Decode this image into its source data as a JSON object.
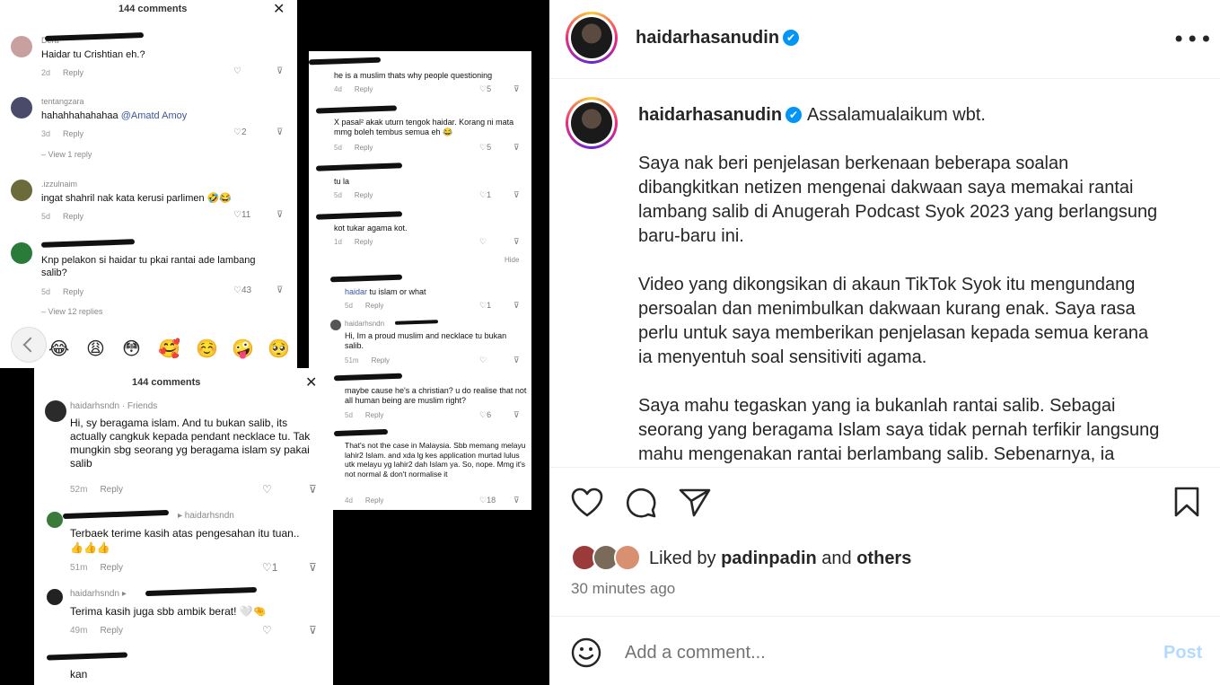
{
  "collage": {
    "shot1": {
      "header": "144 comments",
      "comments": [
        {
          "user": "Dera",
          "text": "Haidar tu Crishtian eh.?",
          "time": "2d",
          "reply": "Reply",
          "likes": ""
        },
        {
          "user": "tentangzara",
          "text": "hahahhahahahaa",
          "mention": "@Amatd Amoy",
          "time": "3d",
          "reply": "Reply",
          "likes": "2",
          "view": "View 1 reply"
        },
        {
          "user": ".izzulnaim",
          "text": "ingat shahril nak kata kerusi parlimen 🤣😂",
          "time": "5d",
          "reply": "Reply",
          "likes": "11"
        },
        {
          "user": "",
          "text": "Knp pelakon si haidar tu pkai rantai ade lambang salib?",
          "time": "5d",
          "reply": "Reply",
          "likes": "43",
          "view": "View 12 replies"
        }
      ],
      "emojis": [
        "😂",
        "😩",
        "😳",
        "🥰",
        "☺️",
        "🤪",
        "🥺"
      ]
    },
    "shot2": {
      "comments": [
        {
          "text": "he is a muslim thats why people questioning",
          "time": "4d",
          "reply": "Reply",
          "likes": "5"
        },
        {
          "text": "X pasal² akak uturn tengok haidar. Korang ni mata mmg boleh tembus semua eh 😂",
          "time": "5d",
          "reply": "Reply",
          "likes": "5"
        },
        {
          "text": "tu la",
          "time": "5d",
          "reply": "Reply",
          "likes": "1"
        },
        {
          "text": "kot tukar agama kot.",
          "time": "1d",
          "reply": "Reply",
          "likes": ""
        },
        {
          "hide": "Hide"
        },
        {
          "mention": "haidar",
          "text": " tu islam or what",
          "time": "5d",
          "reply": "Reply",
          "likes": "1"
        },
        {
          "user": "haidarhsndn",
          "text": "Hi, Im a proud muslim and necklace tu bukan salib.",
          "time": "51m",
          "reply": "Reply",
          "likes": ""
        },
        {
          "text": "maybe cause he's a christian? u do realise that not all human being are muslim right?",
          "time": "5d",
          "reply": "Reply",
          "likes": "6"
        },
        {
          "text": "That's not the case in Malaysia. Sbb memang melayu lahir2 Islam. and xda lg kes application murtad lulus utk melayu yg lahir2 dah Islam ya. So, nope. Mmg it's not normal & don't normalise it",
          "time": "4d",
          "reply": "Reply",
          "likes": "18"
        }
      ]
    },
    "shot3": {
      "header": "144 comments",
      "comments": [
        {
          "user": "haidarhsndn",
          "tag": "· Friends",
          "text": "Hi, sy beragama islam. And tu bukan salib, its actually cangkuk kepada pendant necklace tu. Tak mungkin sbg seorang yg beragama islam sy pakai salib",
          "time": "52m",
          "reply": "Reply",
          "likes": ""
        },
        {
          "user": "",
          "tag": "▸ haidarhsndn",
          "text": "Terbaek terime kasih atas pengesahan itu tuan.. 👍👍👍",
          "time": "51m",
          "reply": "Reply",
          "likes": "1"
        },
        {
          "user": "haidarhsndn",
          "tag": "▸",
          "text": "Terima kasih juga sbb ambik berat! 🤍🤏",
          "time": "49m",
          "reply": "Reply",
          "likes": ""
        },
        {
          "user": "",
          "text": "kan"
        }
      ]
    }
  },
  "post": {
    "username": "haidarhasanudin",
    "verified_icon": "✔",
    "more_icon": "•••",
    "caption_first": "Assalamualaikum wbt.",
    "caption_paragraphs": [
      "Saya nak beri penjelasan berkenaan beberapa soalan\ndibangkitkan netizen mengenai dakwaan saya memakai rantai\nlambang salib di Anugerah Podcast Syok 2023 yang berlangsung\nbaru-baru ini.",
      "Video yang dikongsikan di akaun TikTok Syok itu mengundang\npersoalan dan menimbulkan dakwaan kurang enak. Saya rasa\nperlu untuk saya memberikan penjelasan kepada semua kerana\nia menyentuh soal sensitiviti agama.",
      "Saya mahu tegaskan yang ia bukanlah rantai salib. Sebagai\nseorang yang beragama Islam saya tidak pernah terfikir langsung\nmahu mengenakan rantai berlambang salib. Sebenarnya, ia"
    ],
    "liked_prefix": "Liked by ",
    "liked_user": "padinpadin",
    "liked_and": " and ",
    "liked_others": "others",
    "time_ago": "30 minutes ago",
    "comment_placeholder": "Add a comment...",
    "post_button": "Post"
  }
}
